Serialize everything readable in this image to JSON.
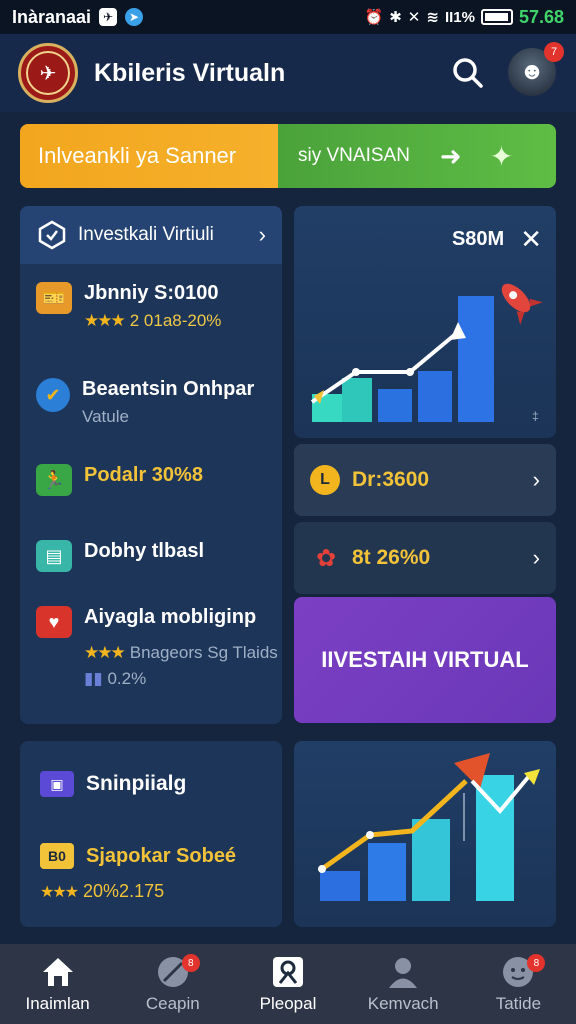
{
  "status_bar": {
    "carrier": "Inàranaai",
    "time": "57.68",
    "battery_text": "II1%"
  },
  "header": {
    "title": "Kbileris Virtualn",
    "avatar_badge": "7"
  },
  "banner": {
    "left_text": "Inlveankli ya Sanner",
    "right_text": "siy VNAISAN"
  },
  "left_panel": {
    "header": "Investkali Virtiuli",
    "items": [
      {
        "title": "Jbnniy S:0100",
        "sub": "2 01a8-20%",
        "icon": "tickets-icon"
      },
      {
        "title": "Beaentsin Onhpar",
        "sub": "Vatule",
        "icon": "check-badge-icon"
      },
      {
        "title": "Podalr 30%8",
        "sub": "",
        "icon": "runner-icon"
      },
      {
        "title": "Dobhy tlbasl",
        "sub": "",
        "icon": "shield-card-icon"
      },
      {
        "title": "Aiyagla mobliginp",
        "sub": "Bnageors Sg Tlaids",
        "sub2": "0.2%",
        "icon": "heart-box-icon"
      }
    ]
  },
  "chart_panel": {
    "label": "S80M"
  },
  "row_cards": [
    {
      "text": "Dr:3600",
      "icon": "coin-icon"
    },
    {
      "text": "8t 26%0",
      "icon": "rose-icon"
    }
  ],
  "cta": {
    "label": "IIVESTAIH VIRTUAL"
  },
  "bottom_left": {
    "item1": "Sninpiialg",
    "item2": "Sjapokar Sobeé",
    "item3": "20%2.175",
    "badge": "B0"
  },
  "nav": [
    {
      "label": "Inaimlan",
      "icon": "home-icon",
      "active": true
    },
    {
      "label": "Ceapin",
      "icon": "compass-icon",
      "badge": "8"
    },
    {
      "label": "Pleopal",
      "icon": "profile-card-icon"
    },
    {
      "label": "Kemvach",
      "icon": "person-icon"
    },
    {
      "label": "Tatide",
      "icon": "chat-face-icon",
      "badge": "8"
    }
  ],
  "colors": {
    "background": "#15253e",
    "panel": "#1d3558",
    "accent_orange": "#f2a61e",
    "accent_green": "#5fbd45",
    "accent_purple": "#7c3fc4",
    "gold": "#f2c238"
  }
}
